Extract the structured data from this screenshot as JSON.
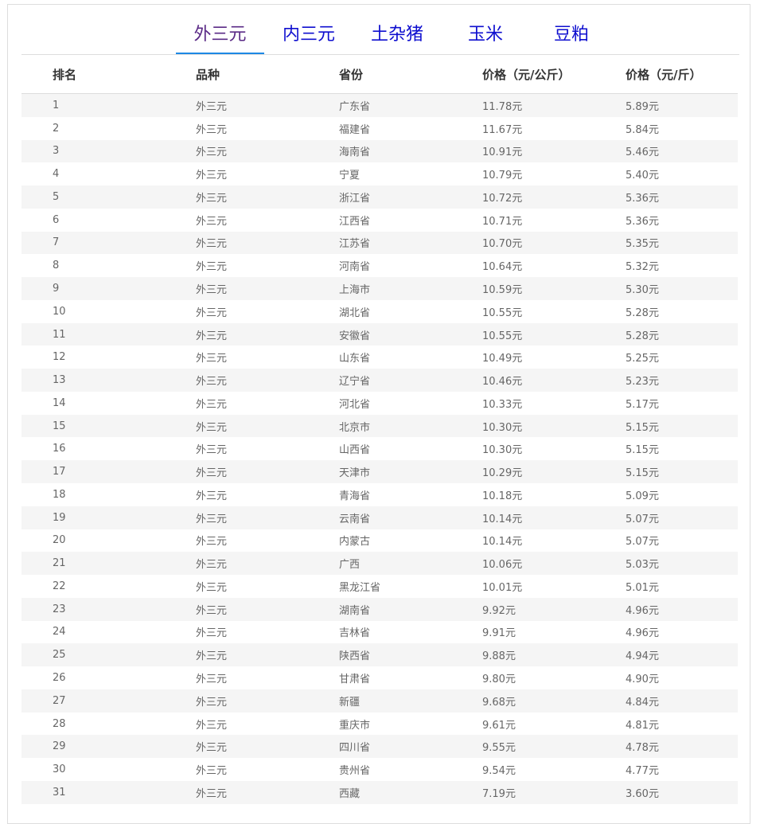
{
  "tabs": [
    {
      "label": "外三元",
      "active": true
    },
    {
      "label": "内三元",
      "active": false
    },
    {
      "label": "土杂猪",
      "active": false
    },
    {
      "label": "玉米",
      "active": false
    },
    {
      "label": "豆粕",
      "active": false
    }
  ],
  "table": {
    "headers": [
      "排名",
      "品种",
      "省份",
      "价格（元/公斤）",
      "价格（元/斤）"
    ],
    "rows": [
      [
        "1",
        "外三元",
        "广东省",
        "11.78元",
        "5.89元"
      ],
      [
        "2",
        "外三元",
        "福建省",
        "11.67元",
        "5.84元"
      ],
      [
        "3",
        "外三元",
        "海南省",
        "10.91元",
        "5.46元"
      ],
      [
        "4",
        "外三元",
        "宁夏",
        "10.79元",
        "5.40元"
      ],
      [
        "5",
        "外三元",
        "浙江省",
        "10.72元",
        "5.36元"
      ],
      [
        "6",
        "外三元",
        "江西省",
        "10.71元",
        "5.36元"
      ],
      [
        "7",
        "外三元",
        "江苏省",
        "10.70元",
        "5.35元"
      ],
      [
        "8",
        "外三元",
        "河南省",
        "10.64元",
        "5.32元"
      ],
      [
        "9",
        "外三元",
        "上海市",
        "10.59元",
        "5.30元"
      ],
      [
        "10",
        "外三元",
        "湖北省",
        "10.55元",
        "5.28元"
      ],
      [
        "11",
        "外三元",
        "安徽省",
        "10.55元",
        "5.28元"
      ],
      [
        "12",
        "外三元",
        "山东省",
        "10.49元",
        "5.25元"
      ],
      [
        "13",
        "外三元",
        "辽宁省",
        "10.46元",
        "5.23元"
      ],
      [
        "14",
        "外三元",
        "河北省",
        "10.33元",
        "5.17元"
      ],
      [
        "15",
        "外三元",
        "北京市",
        "10.30元",
        "5.15元"
      ],
      [
        "16",
        "外三元",
        "山西省",
        "10.30元",
        "5.15元"
      ],
      [
        "17",
        "外三元",
        "天津市",
        "10.29元",
        "5.15元"
      ],
      [
        "18",
        "外三元",
        "青海省",
        "10.18元",
        "5.09元"
      ],
      [
        "19",
        "外三元",
        "云南省",
        "10.14元",
        "5.07元"
      ],
      [
        "20",
        "外三元",
        "内蒙古",
        "10.14元",
        "5.07元"
      ],
      [
        "21",
        "外三元",
        "广西",
        "10.06元",
        "5.03元"
      ],
      [
        "22",
        "外三元",
        "黑龙江省",
        "10.01元",
        "5.01元"
      ],
      [
        "23",
        "外三元",
        "湖南省",
        "9.92元",
        "4.96元"
      ],
      [
        "24",
        "外三元",
        "吉林省",
        "9.91元",
        "4.96元"
      ],
      [
        "25",
        "外三元",
        "陕西省",
        "9.88元",
        "4.94元"
      ],
      [
        "26",
        "外三元",
        "甘肃省",
        "9.80元",
        "4.90元"
      ],
      [
        "27",
        "外三元",
        "新疆",
        "9.68元",
        "4.84元"
      ],
      [
        "28",
        "外三元",
        "重庆市",
        "9.61元",
        "4.81元"
      ],
      [
        "29",
        "外三元",
        "四川省",
        "9.55元",
        "4.78元"
      ],
      [
        "30",
        "外三元",
        "贵州省",
        "9.54元",
        "4.77元"
      ],
      [
        "31",
        "外三元",
        "西藏",
        "7.19元",
        "3.60元"
      ]
    ]
  }
}
